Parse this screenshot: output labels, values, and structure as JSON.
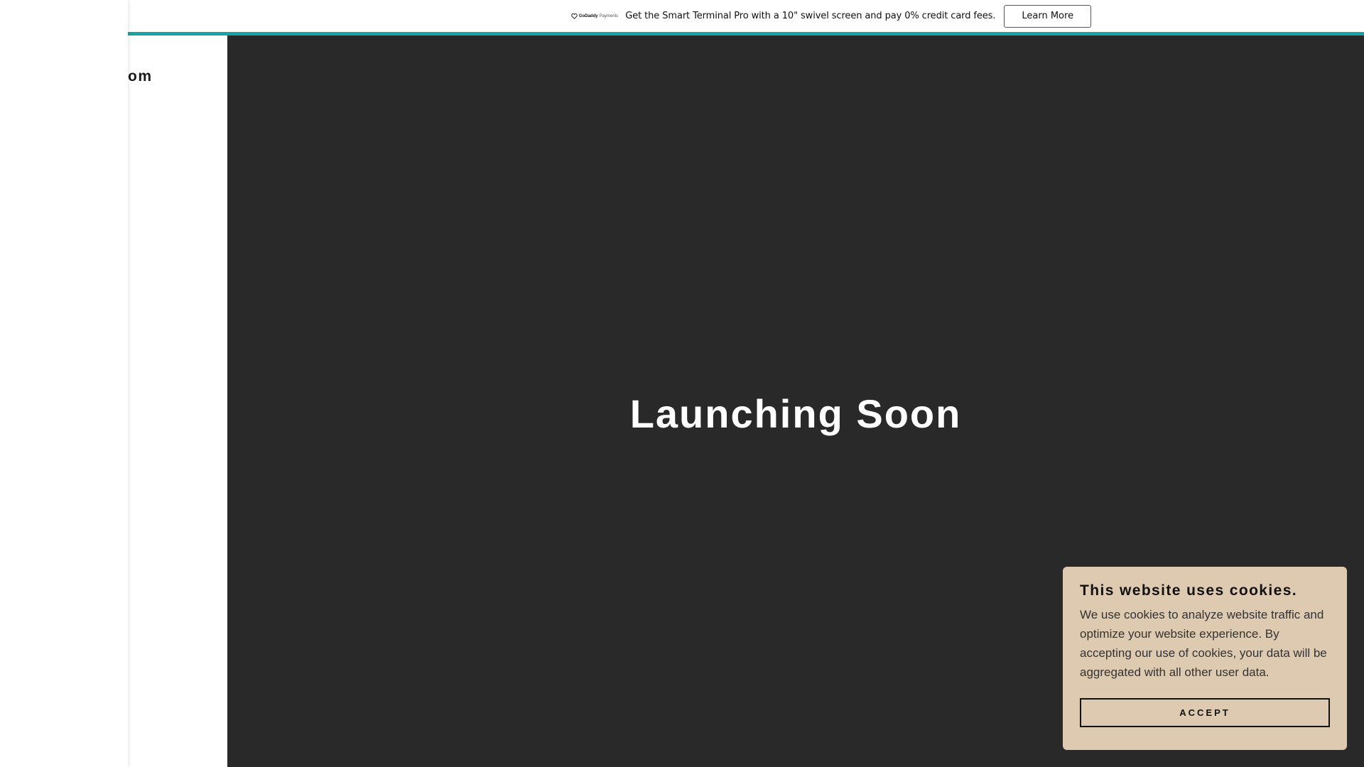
{
  "promo": {
    "logo_text": "GoDaddy",
    "logo_subtext": "Payments",
    "message": "Get the Smart Terminal Pro with a 10\" swivel screen and pay 0% credit card fees.",
    "button_label": "Learn More",
    "accent_color": "#1aa3a3"
  },
  "header": {
    "site_title_partial": "om"
  },
  "hero": {
    "title": "Launching Soon",
    "background_color": "#292929"
  },
  "cookie_banner": {
    "title": "This website uses cookies.",
    "body": "We use cookies to analyze website traffic and optimize your website experience. By accepting our use of cookies, your data will be aggregated with all other user data.",
    "accept_label": "ACCEPT",
    "background_color": "#decab0"
  }
}
